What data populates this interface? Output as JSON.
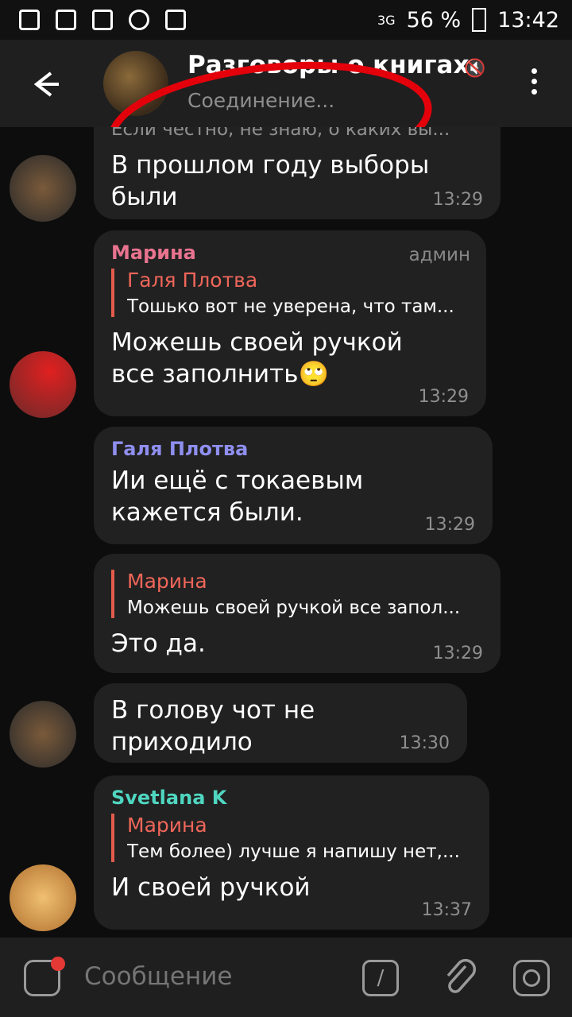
{
  "status_bar": {
    "battery": "56 %",
    "time": "13:42",
    "network": "3G"
  },
  "header": {
    "title": "Разговоры о книгах",
    "subtitle": "Соединение..."
  },
  "messages": [
    {
      "reply_text": "Если честно, не знаю, о каких вы...",
      "text": "В прошлом году выборы были",
      "time": "13:29"
    },
    {
      "sender": "Марина",
      "badge": "админ",
      "reply_name": "Галя Плотва",
      "reply_text": "Тошько вот не уверена, что там...",
      "text": "Можешь своей ручкой все заполнить🙄",
      "time": "13:29"
    },
    {
      "sender": "Галя Плотва",
      "text": "Ии ещё с токаевым кажется были.",
      "time": "13:29"
    },
    {
      "reply_name": "Марина",
      "reply_text": "Можешь своей ручкой все запол...",
      "text": "Это да.",
      "time": "13:29"
    },
    {
      "text": "В голову чот не приходило",
      "time": "13:30"
    },
    {
      "sender": "Svetlana K",
      "reply_name": "Марина",
      "reply_text": "Тем более) лучше я напишу нет,...",
      "text": "И своей ручкой",
      "time": "13:37"
    }
  ],
  "composer": {
    "placeholder": "Сообщение",
    "command_symbol": "/"
  },
  "colors": {
    "sender_marina": "#e8738f",
    "sender_galya": "#8f8ff0",
    "sender_svetlana": "#4fd6c0",
    "reply_accent": "#f0665a",
    "annotation": "#e3000b"
  }
}
